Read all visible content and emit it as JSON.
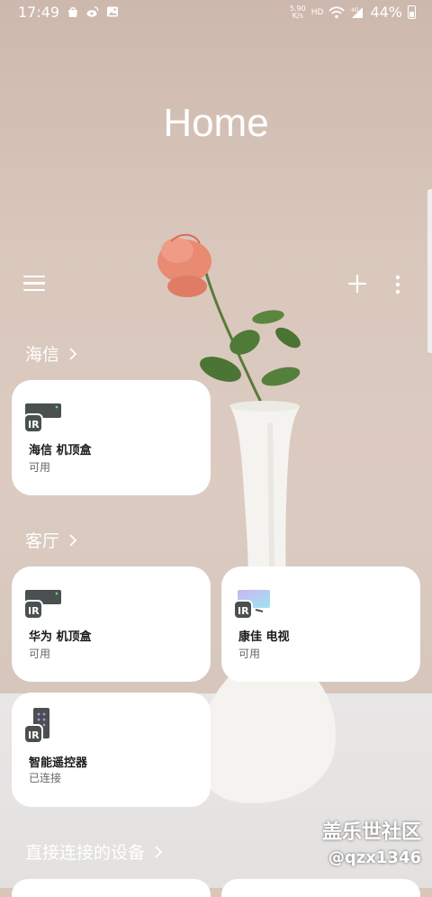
{
  "status_bar": {
    "time": "17:49",
    "net_speed_top": "5.90",
    "net_speed_bottom": "K/s",
    "hd_label": "HD",
    "battery_percent": "44%",
    "battery_level": 0.44,
    "left_icons": [
      "bag-icon",
      "weibo-icon",
      "image-icon"
    ],
    "right_icons": [
      "wifi-icon",
      "signal-4g-icon",
      "battery-icon"
    ]
  },
  "header": {
    "title": "Home",
    "menu_icon": "menu-icon",
    "add_icon": "plus-icon",
    "more_icon": "more-vertical-icon"
  },
  "sections": [
    {
      "title": "海信",
      "cards": [
        {
          "name": "海信 机顶盒",
          "status": "可用",
          "icon": "ir-set-top-box-icon"
        }
      ]
    },
    {
      "title": "客厅",
      "cards": [
        {
          "name": "华为 机顶盒",
          "status": "可用",
          "icon": "ir-set-top-box-icon"
        },
        {
          "name": "康佳 电视",
          "status": "可用",
          "icon": "ir-tv-icon"
        },
        {
          "name": "智能遥控器",
          "status": "已连接",
          "icon": "ir-remote-icon"
        }
      ]
    },
    {
      "title": "直接连接的设备",
      "cards": []
    }
  ],
  "watermark": {
    "line1": "盖乐世社区",
    "line2": "@qzx1346"
  },
  "colors": {
    "wall": "#d8c6bb",
    "card": "#ffffff",
    "text_primary": "#1a1a1a",
    "text_secondary": "#666666"
  }
}
